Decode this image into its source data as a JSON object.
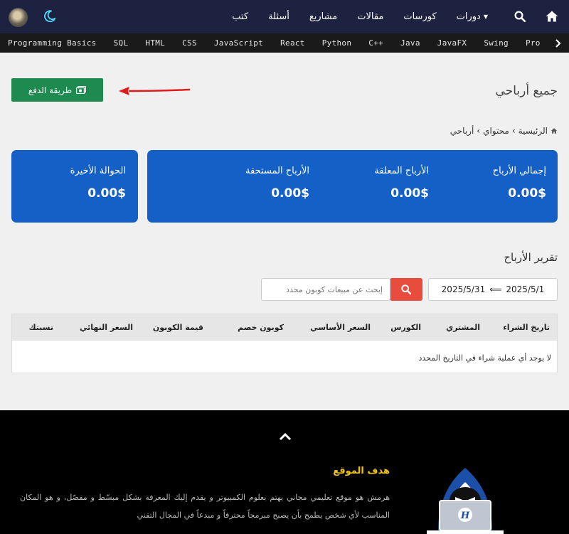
{
  "nav": {
    "menu": [
      {
        "label": "دورات",
        "has_dropdown": true
      },
      {
        "label": "كورسات",
        "has_dropdown": false
      },
      {
        "label": "مقالات",
        "has_dropdown": false
      },
      {
        "label": "مشاريع",
        "has_dropdown": false
      },
      {
        "label": "أسئلة",
        "has_dropdown": false
      },
      {
        "label": "كتب",
        "has_dropdown": false
      }
    ],
    "icons": [
      "home-icon",
      "search-icon",
      "moon-icon",
      "avatar"
    ],
    "background": "#1c2240"
  },
  "categories": [
    "Programming Basics",
    "SQL",
    "HTML",
    "CSS",
    "JavaScript",
    "React",
    "Python",
    "C++",
    "Java",
    "JavaFX",
    "Swing",
    "Pro"
  ],
  "header": {
    "pay_button": "طريقة الدفع",
    "title": "جميع أرباحي",
    "breadcrumb": [
      "الرئيسية",
      "محتواي",
      "أرباحي"
    ]
  },
  "stats": {
    "total_label": "إجمالي الأرباح",
    "total_value": "0.00$",
    "pending_label": "الأرباح المعلقة",
    "pending_value": "0.00$",
    "due_label": "الأرباح المستحقة",
    "due_value": "0.00$",
    "last_transfer_label": "الحوالة الأخيرة",
    "last_transfer_value": "0.00$",
    "card_color": "#1560c7"
  },
  "report": {
    "title": "تقرير الأرباح",
    "date_from": "2025/5/1",
    "date_separator": "⟸",
    "date_to": "2025/5/31",
    "search_placeholder": "إبحث عن مبيعات كوبون محدد",
    "columns": [
      "تاريخ الشراء",
      "المشتري",
      "الكورس",
      "السعر الأساسي",
      "كوبون خصم",
      "قيمة الكوبون",
      "السعر النهائي",
      "نسبتك"
    ],
    "empty_message": "لا يوجد أي عملية شراء في التاريخ المحدد"
  },
  "footer": {
    "title": "هدف الموقع",
    "text": "هرمش هو موقع تعليمي مجاني يهتم بعلوم الكمبيوتر و يقدم إليك المعرفة بشكل مبسّط و مفصّل، و هو المكان المناسب لأي شخص يطمح بأن يصبح مبرمجاً محترفاً و مبدعاً في المجال التقني",
    "title_color": "#f1c40f"
  }
}
